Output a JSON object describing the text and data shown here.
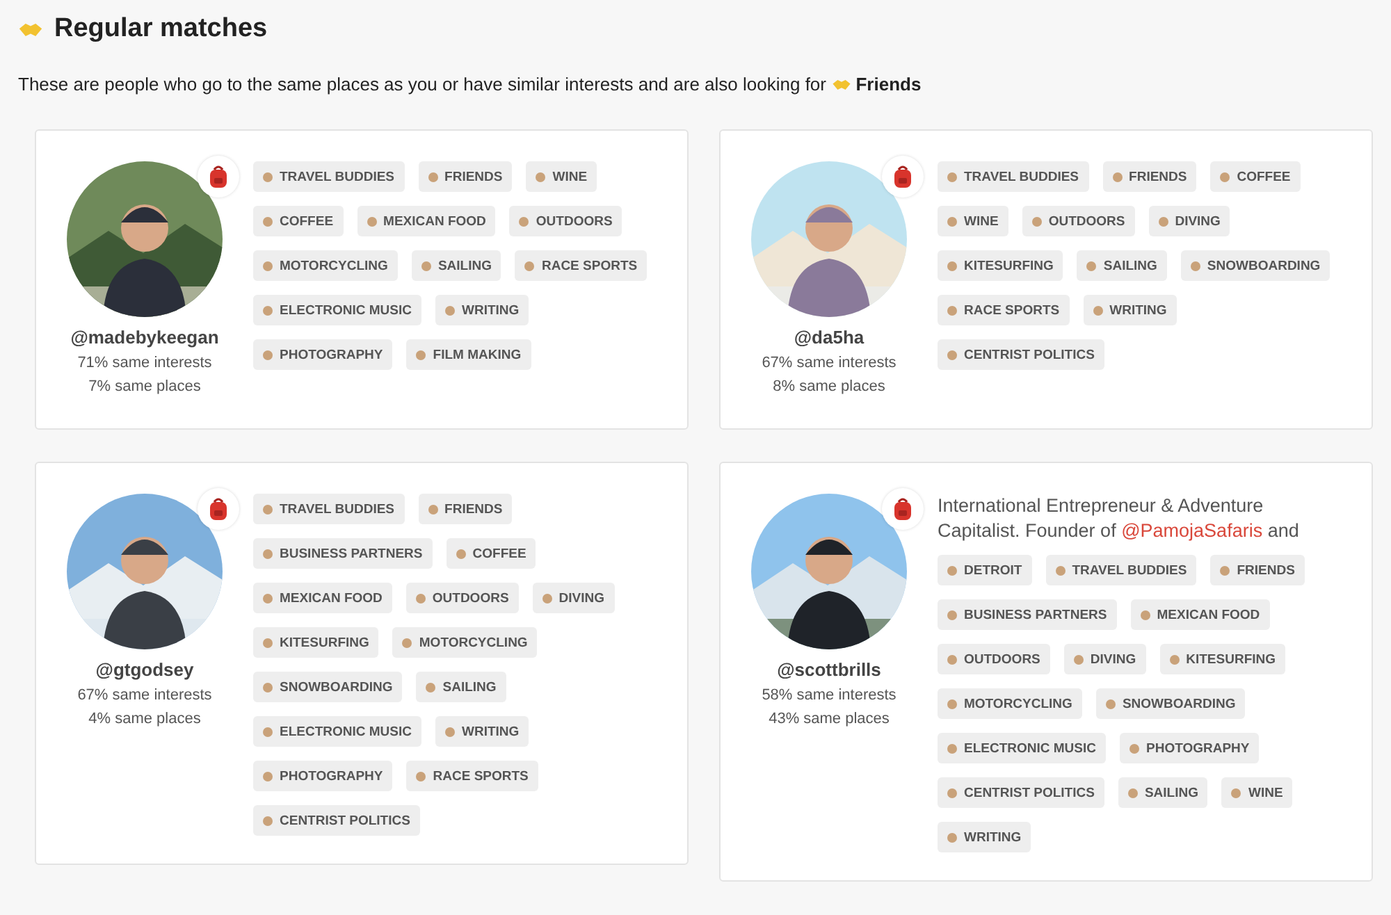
{
  "title": "Regular matches",
  "subtitle": {
    "text": "These are people who go to the same places as you or have similar interests and are also looking for",
    "highlight": "Friends"
  },
  "matches": [
    {
      "username": "@madebykeegan",
      "interests": "71% same interests",
      "places": "7% same places",
      "tags": [
        "TRAVEL BUDDIES",
        "FRIENDS",
        "WINE",
        "COFFEE",
        "MEXICAN FOOD",
        "OUTDOORS",
        "MOTORCYCLING",
        "SAILING",
        "RACE SPORTS",
        "ELECTRONIC MUSIC",
        "WRITING",
        "PHOTOGRAPHY",
        "FILM MAKING"
      ]
    },
    {
      "username": "@da5ha",
      "interests": "67% same interests",
      "places": "8% same places",
      "tags": [
        "TRAVEL BUDDIES",
        "FRIENDS",
        "COFFEE",
        "WINE",
        "OUTDOORS",
        "DIVING",
        "KITESURFING",
        "SAILING",
        "SNOWBOARDING",
        "RACE SPORTS",
        "WRITING",
        "CENTRIST POLITICS"
      ]
    },
    {
      "username": "@gtgodsey",
      "interests": "67% same interests",
      "places": "4% same places",
      "tags": [
        "TRAVEL BUDDIES",
        "FRIENDS",
        "BUSINESS PARTNERS",
        "COFFEE",
        "MEXICAN FOOD",
        "OUTDOORS",
        "DIVING",
        "KITESURFING",
        "MOTORCYCLING",
        "SNOWBOARDING",
        "SAILING",
        "ELECTRONIC MUSIC",
        "WRITING",
        "PHOTOGRAPHY",
        "RACE SPORTS",
        "CENTRIST POLITICS"
      ]
    },
    {
      "username": "@scottbrills",
      "interests": "58% same interests",
      "places": "43% same places",
      "bio": {
        "text": "International Entrepreneur & Adventure Capitalist. Founder of",
        "link": "@PamojaSafaris",
        "after": "and"
      },
      "tags": [
        "DETROIT",
        "TRAVEL BUDDIES",
        "FRIENDS",
        "BUSINESS PARTNERS",
        "MEXICAN FOOD",
        "OUTDOORS",
        "DIVING",
        "KITESURFING",
        "MOTORCYCLING",
        "SNOWBOARDING",
        "ELECTRONIC MUSIC",
        "PHOTOGRAPHY",
        "CENTRIST POLITICS",
        "SAILING",
        "WINE",
        "WRITING"
      ]
    }
  ]
}
